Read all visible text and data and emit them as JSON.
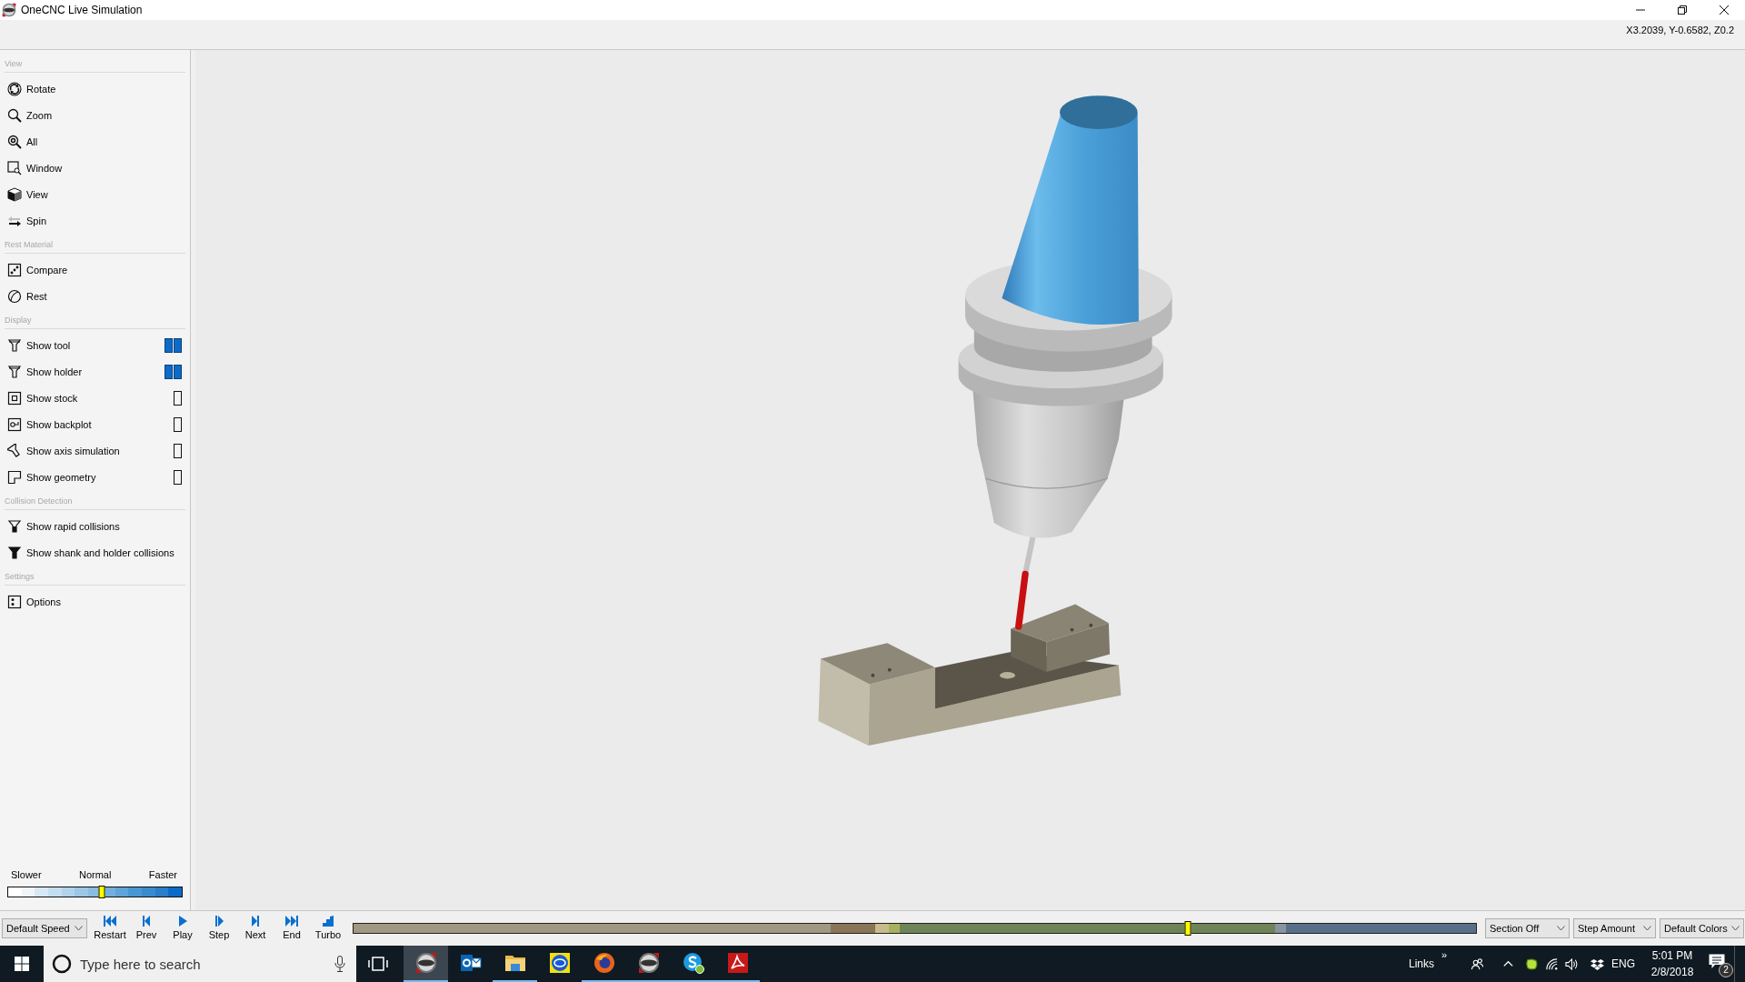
{
  "window": {
    "title": "OneCNC Live Simulation",
    "coordinates": "X3.2039, Y-0.6582, Z0.2"
  },
  "sidebar": {
    "sections": [
      {
        "title": "View",
        "items": [
          {
            "label": "Rotate",
            "kind": "action"
          },
          {
            "label": "Zoom",
            "kind": "action"
          },
          {
            "label": "All",
            "kind": "action"
          },
          {
            "label": "Window",
            "kind": "action"
          },
          {
            "label": "View",
            "kind": "action"
          },
          {
            "label": "Spin",
            "kind": "action"
          }
        ]
      },
      {
        "title": "Rest Material",
        "items": [
          {
            "label": "Compare",
            "kind": "action"
          },
          {
            "label": "Rest",
            "kind": "action"
          }
        ]
      },
      {
        "title": "Display",
        "items": [
          {
            "label": "Show tool",
            "kind": "toggle",
            "on": true
          },
          {
            "label": "Show holder",
            "kind": "toggle",
            "on": true
          },
          {
            "label": "Show stock",
            "kind": "toggle",
            "on": false
          },
          {
            "label": "Show backplot",
            "kind": "toggle",
            "on": false
          },
          {
            "label": "Show axis simulation",
            "kind": "toggle",
            "on": false
          },
          {
            "label": "Show geometry",
            "kind": "toggle",
            "on": false
          }
        ]
      },
      {
        "title": "Collision Detection",
        "items": [
          {
            "label": "Show rapid collisions",
            "kind": "action"
          },
          {
            "label": "Show shank and holder collisions",
            "kind": "action"
          }
        ]
      },
      {
        "title": "Settings",
        "items": [
          {
            "label": "Options",
            "kind": "action"
          }
        ]
      }
    ],
    "speed": {
      "labels": [
        "Slower",
        "Normal",
        "Faster"
      ],
      "level": 0.54
    }
  },
  "toolbar": {
    "speed_dropdown": "Default Speed",
    "buttons": [
      "Restart",
      "Prev",
      "Play",
      "Step",
      "Next",
      "End",
      "Turbo"
    ],
    "timeline": {
      "level": 0.743
    },
    "dropdowns": [
      "Section Off",
      "Step Amount",
      "Default Colors"
    ]
  },
  "taskbar": {
    "search": {
      "placeholder": "Type here to search"
    },
    "apps": [
      {
        "selected": true,
        "running": true
      },
      {
        "selected": false,
        "running": false
      },
      {
        "selected": false,
        "running": true
      },
      {
        "selected": false,
        "running": false
      },
      {
        "selected": false,
        "running": true
      },
      {
        "selected": false,
        "running": true
      },
      {
        "selected": false,
        "running": true
      },
      {
        "selected": false,
        "running": true
      }
    ],
    "links": "Links",
    "links_more": "»",
    "language": "ENG",
    "time": "5:01 PM",
    "date": "2/8/2018",
    "notifications": "2"
  }
}
